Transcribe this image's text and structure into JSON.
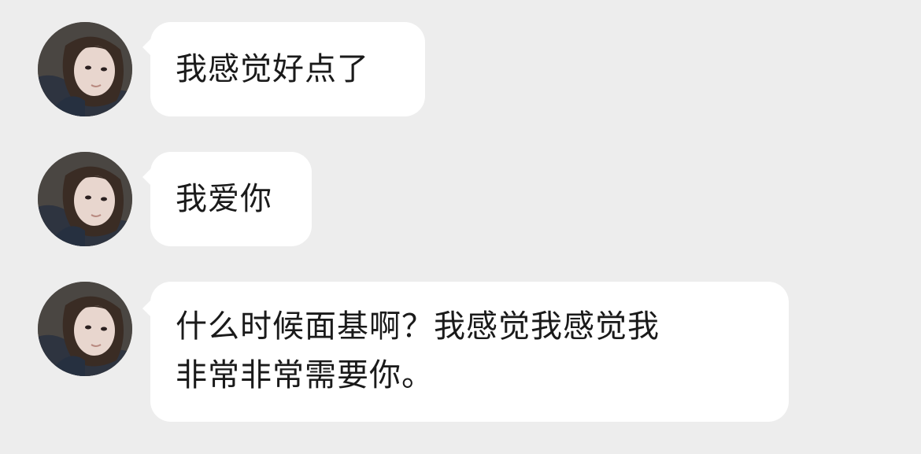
{
  "chat": {
    "messages": [
      {
        "sender": "contact",
        "text": "我感觉好点了"
      },
      {
        "sender": "contact",
        "text": "我爱你"
      },
      {
        "sender": "contact",
        "text": "什么时候面基啊？我感觉我感觉我\n非常非常需要你。"
      }
    ]
  },
  "colors": {
    "background": "#ededed",
    "bubble": "#ffffff",
    "text": "#1a1a1a"
  }
}
